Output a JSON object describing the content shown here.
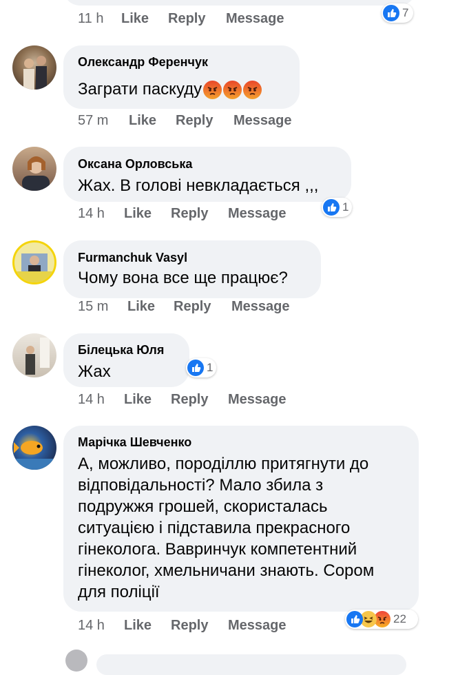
{
  "comments": [
    {
      "name": "",
      "text": "",
      "time": "11 h",
      "like": "Like",
      "reply": "Reply",
      "message": "Message",
      "reactions_count": "7"
    },
    {
      "name": "Олександр Ференчук",
      "text": "Заграти паскуду",
      "emoji": [
        "angry-face-emoji",
        "angry-face-emoji",
        "angry-face-emoji"
      ],
      "time": "57 m",
      "like": "Like",
      "reply": "Reply",
      "message": "Message"
    },
    {
      "name": "Оксана Орловська",
      "text": "Жах. В голові невкладається ,,,",
      "time": "14 h",
      "like": "Like",
      "reply": "Reply",
      "message": "Message",
      "reactions_count": "1"
    },
    {
      "name": "Furmanchuk Vasyl",
      "text": "Чому вона все ще працює?",
      "time": "15 m",
      "like": "Like",
      "reply": "Reply",
      "message": "Message"
    },
    {
      "name": "Білецька Юля",
      "text": "Жах",
      "time": "14 h",
      "like": "Like",
      "reply": "Reply",
      "message": "Message",
      "reactions_count": "1"
    },
    {
      "name": "Марічка Шевченко",
      "lines": [
        "А, можливо, породіллю притягнути до",
        "відповідальності? Мало збила з",
        "подружжя грошей, скористалась",
        "ситуацією і підставила прекрасного",
        "гінеколога. Вавринчук компетентний",
        "гінеколог, хмельничани знають. Сором",
        "для поліції"
      ],
      "time": "14 h",
      "like": "Like",
      "reply": "Reply",
      "message": "Message",
      "reactions_count": "22"
    }
  ],
  "colors": {
    "bubble": "#f0f2f5",
    "meta": "#65676b",
    "like_blue": "#1877f2"
  }
}
